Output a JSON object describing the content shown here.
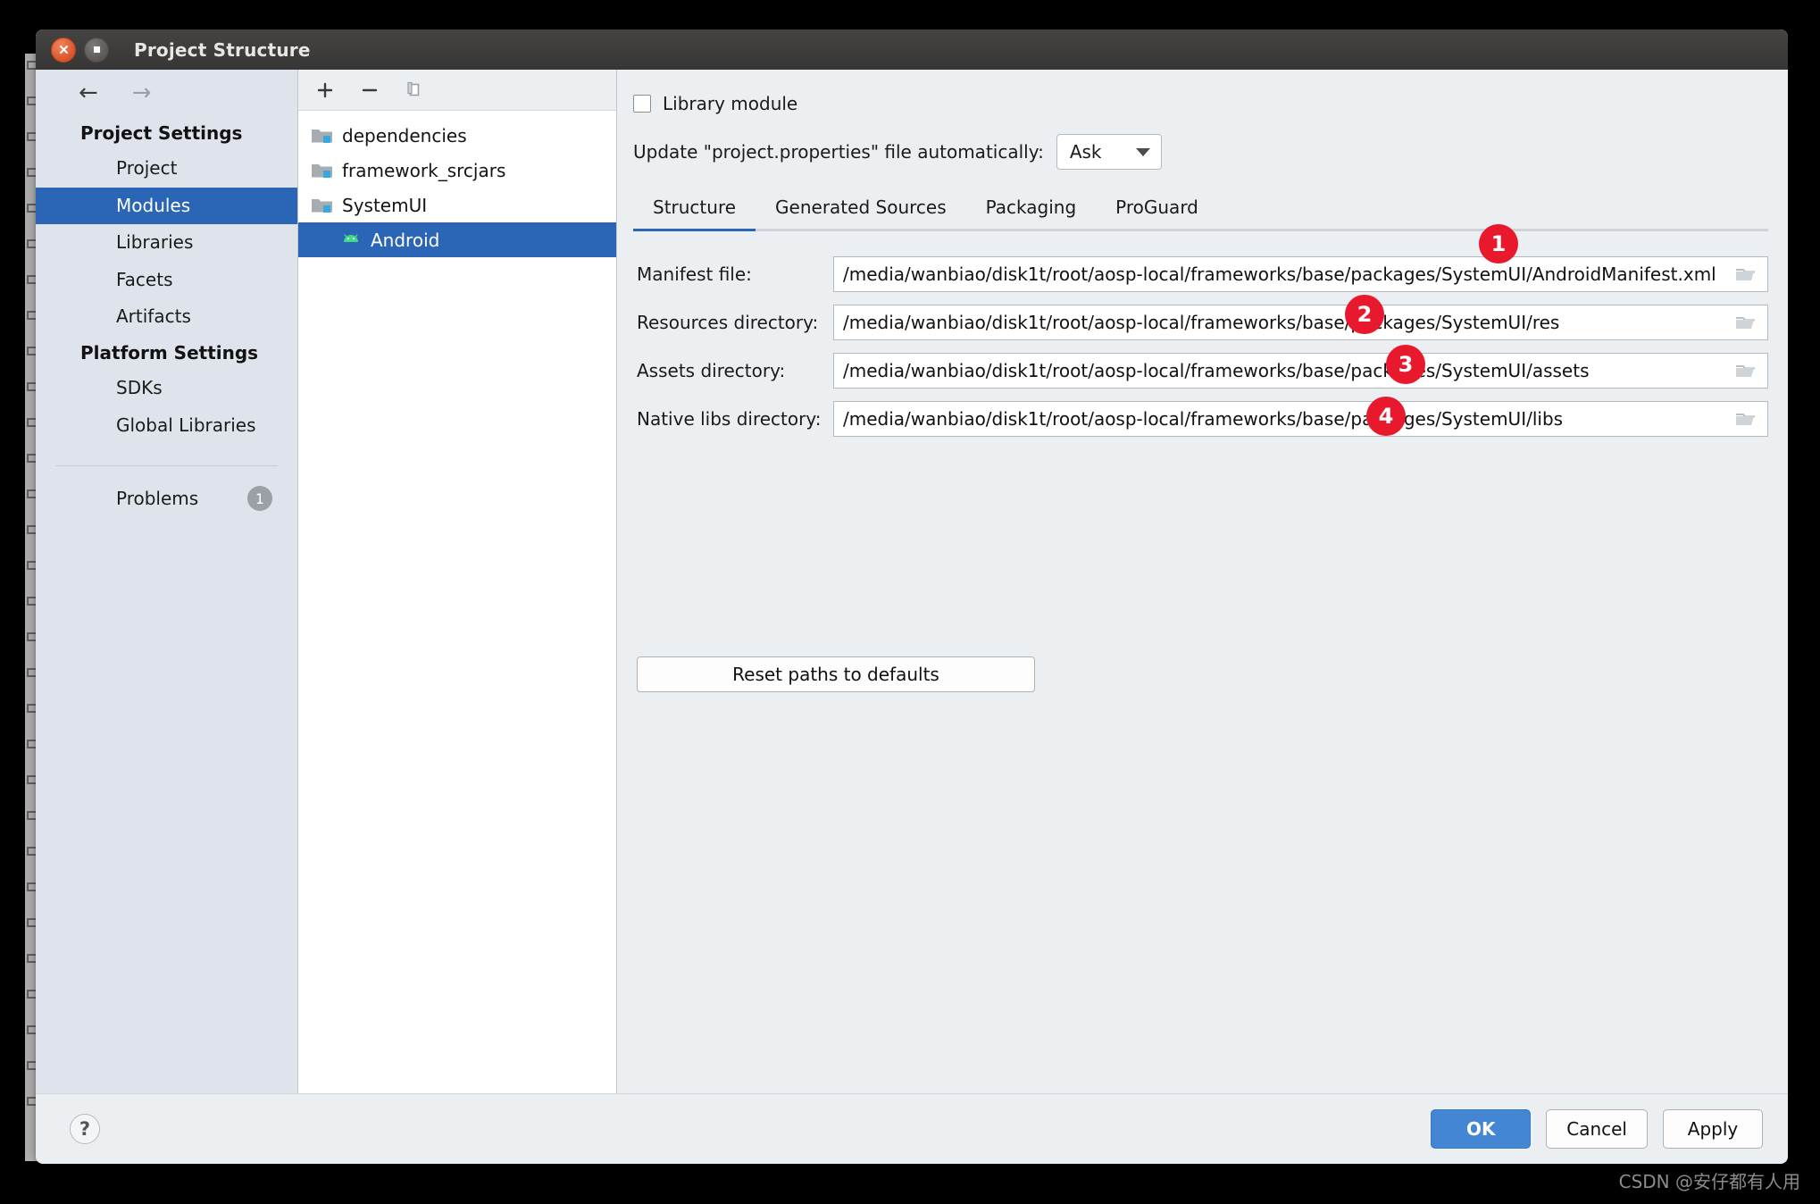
{
  "window": {
    "title": "Project Structure",
    "close_icon": "close-icon",
    "maximize_icon": "maximize-icon"
  },
  "sidebar": {
    "back_arrow": "←",
    "forward_arrow": "→",
    "sections": [
      {
        "heading": "Project Settings",
        "items": [
          {
            "label": "Project",
            "selected": false
          },
          {
            "label": "Modules",
            "selected": true
          },
          {
            "label": "Libraries",
            "selected": false
          },
          {
            "label": "Facets",
            "selected": false
          },
          {
            "label": "Artifacts",
            "selected": false
          }
        ]
      },
      {
        "heading": "Platform Settings",
        "items": [
          {
            "label": "SDKs",
            "selected": false
          },
          {
            "label": "Global Libraries",
            "selected": false
          }
        ]
      }
    ],
    "problems": {
      "label": "Problems",
      "count": "1"
    }
  },
  "tree": {
    "toolbar": {
      "add": "+",
      "remove": "−",
      "copy": "copy-icon"
    },
    "nodes": [
      {
        "label": "dependencies",
        "icon": "module-folder-icon",
        "selected": false,
        "child": false
      },
      {
        "label": "framework_srcjars",
        "icon": "module-folder-icon",
        "selected": false,
        "child": false
      },
      {
        "label": "SystemUI",
        "icon": "module-folder-icon",
        "selected": false,
        "child": false
      },
      {
        "label": "Android",
        "icon": "android-icon",
        "selected": true,
        "child": true
      }
    ]
  },
  "main": {
    "library_module": {
      "label": "Library module",
      "checked": false
    },
    "update_properties": {
      "label": "Update \"project.properties\" file automatically:",
      "value": "Ask"
    },
    "tabs": [
      {
        "label": "Structure",
        "active": true
      },
      {
        "label": "Generated Sources",
        "active": false
      },
      {
        "label": "Packaging",
        "active": false
      },
      {
        "label": "ProGuard",
        "active": false
      }
    ],
    "fields": [
      {
        "label": "Manifest file:",
        "value": "/media/wanbiao/disk1t/root/aosp-local/frameworks/base/packages/SystemUI/AndroidManifest.xml",
        "marker": "1"
      },
      {
        "label": "Resources directory:",
        "value": "/media/wanbiao/disk1t/root/aosp-local/frameworks/base/packages/SystemUI/res",
        "marker": "2"
      },
      {
        "label": "Assets directory:",
        "value": "/media/wanbiao/disk1t/root/aosp-local/frameworks/base/packages/SystemUI/assets",
        "marker": "3"
      },
      {
        "label": "Native libs directory:",
        "value": "/media/wanbiao/disk1t/root/aosp-local/frameworks/base/packages/SystemUI/libs",
        "marker": "4"
      }
    ],
    "reset_button": "Reset paths to defaults"
  },
  "footer": {
    "help": "?",
    "ok": "OK",
    "cancel": "Cancel",
    "apply": "Apply"
  },
  "watermark": "CSDN @安仔都有人用",
  "colors": {
    "accent": "#2b65b5",
    "primary_button": "#4286d4",
    "marker_red": "#e8192c",
    "badge_gray": "#9aa0a6",
    "sidebar_bg": "#dfe4ec"
  }
}
